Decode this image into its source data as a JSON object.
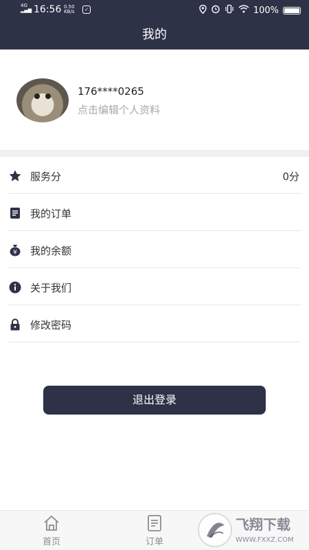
{
  "status_bar": {
    "network": "4G",
    "time": "16:56",
    "speed_value": "0.50",
    "speed_unit": "KB/s",
    "battery": "100%"
  },
  "header": {
    "title": "我的"
  },
  "profile": {
    "phone": "176****0265",
    "edit_hint": "点击编辑个人资料"
  },
  "menu": {
    "items": [
      {
        "label": "服务分",
        "value": "0分",
        "icon": "star-icon"
      },
      {
        "label": "我的订单",
        "value": "",
        "icon": "document-icon"
      },
      {
        "label": "我的余额",
        "value": "",
        "icon": "money-bag-icon"
      },
      {
        "label": "关于我们",
        "value": "",
        "icon": "info-icon"
      },
      {
        "label": "修改密码",
        "value": "",
        "icon": "lock-icon"
      }
    ]
  },
  "logout_label": "退出登录",
  "tabs": [
    {
      "label": "首页",
      "icon": "home-icon"
    },
    {
      "label": "订单",
      "icon": "orders-icon"
    }
  ],
  "watermark": {
    "brand": "飞翔下载",
    "url": "WWW.FXXZ.COM"
  },
  "colors": {
    "primary": "#2e3247",
    "background": "#ffffff",
    "muted_text": "#a8a8a8",
    "divider": "#f0f0f0"
  }
}
